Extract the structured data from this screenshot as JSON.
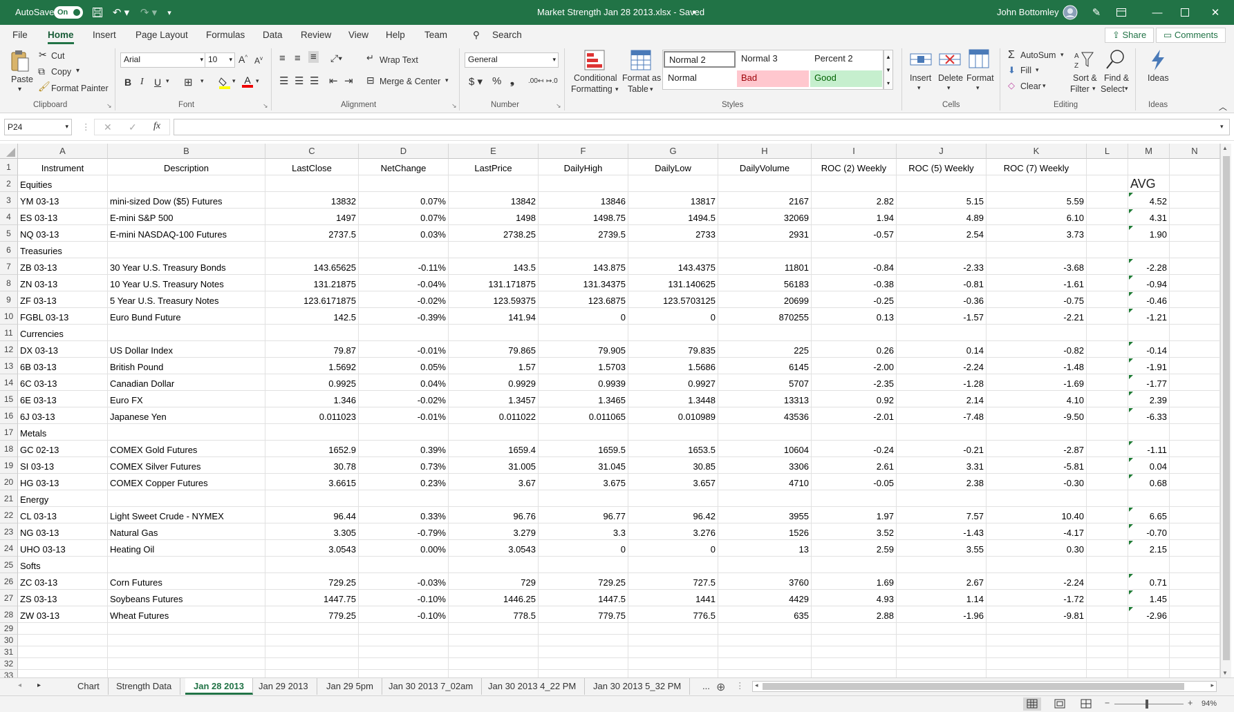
{
  "titlebar": {
    "autosave_label": "AutoSave",
    "autosave_state": "On",
    "file_title": "Market Strength Jan 28 2013.xlsx  -  Saved",
    "user": "John Bottomley"
  },
  "menu": {
    "tabs": [
      "File",
      "Home",
      "Insert",
      "Page Layout",
      "Formulas",
      "Data",
      "Review",
      "View",
      "Help",
      "Team"
    ],
    "search": "Search",
    "share": "Share",
    "comments": "Comments"
  },
  "ribbon": {
    "clipboard": {
      "paste": "Paste",
      "cut": "Cut",
      "copy": "Copy",
      "format_painter": "Format Painter",
      "group": "Clipboard"
    },
    "font": {
      "name": "Arial",
      "size": "10",
      "group": "Font"
    },
    "alignment": {
      "wrap": "Wrap Text",
      "merge": "Merge & Center",
      "group": "Alignment"
    },
    "number": {
      "format": "General",
      "group": "Number"
    },
    "styles": {
      "conditional": "Conditional",
      "conditional2": "Formatting",
      "format_as": "Format as",
      "format_as2": "Table",
      "normal2": "Normal 2",
      "normal3": "Normal 3",
      "percent2": "Percent 2",
      "normal": "Normal",
      "bad": "Bad",
      "good": "Good",
      "group": "Styles"
    },
    "cells": {
      "insert": "Insert",
      "delete": "Delete",
      "format": "Format",
      "group": "Cells"
    },
    "editing": {
      "autosum": "AutoSum",
      "fill": "Fill",
      "clear": "Clear",
      "sort": "Sort &",
      "sort2": "Filter",
      "find": "Find &",
      "find2": "Select",
      "group": "Editing"
    },
    "ideas": {
      "label": "Ideas",
      "group": "Ideas"
    }
  },
  "formula_bar": {
    "name_box": "P24",
    "fx": "fx",
    "value": ""
  },
  "columns": [
    "A",
    "B",
    "C",
    "D",
    "E",
    "F",
    "G",
    "H",
    "I",
    "J",
    "K",
    "L",
    "M",
    "N"
  ],
  "header_row": [
    "Instrument",
    "Description",
    "LastClose",
    "NetChange",
    "LastPrice",
    "DailyHigh",
    "DailyLow",
    "DailyVolume",
    "ROC (2) Weekly",
    "ROC (5) Weekly",
    "ROC (7) Weekly",
    "",
    "",
    ""
  ],
  "avg_label": "AVG",
  "rows": [
    {
      "n": "2",
      "cells": [
        "Equities",
        "",
        "",
        "",
        "",
        "",
        "",
        "",
        "",
        "",
        "",
        "",
        "",
        ""
      ]
    },
    {
      "n": "3",
      "cells": [
        "YM 03-13",
        "mini-sized Dow ($5) Futures",
        "13832",
        "0.07%",
        "13842",
        "13846",
        "13817",
        "2167",
        "2.82",
        "5.15",
        "5.59",
        "",
        "4.52",
        ""
      ]
    },
    {
      "n": "4",
      "cells": [
        "ES 03-13",
        "E-mini S&P 500",
        "1497",
        "0.07%",
        "1498",
        "1498.75",
        "1494.5",
        "32069",
        "1.94",
        "4.89",
        "6.10",
        "",
        "4.31",
        ""
      ]
    },
    {
      "n": "5",
      "cells": [
        "NQ 03-13",
        "E-mini NASDAQ-100 Futures",
        "2737.5",
        "0.03%",
        "2738.25",
        "2739.5",
        "2733",
        "2931",
        "-0.57",
        "2.54",
        "3.73",
        "",
        "1.90",
        ""
      ]
    },
    {
      "n": "6",
      "cells": [
        "Treasuries",
        "",
        "",
        "",
        "",
        "",
        "",
        "",
        "",
        "",
        "",
        "",
        "",
        ""
      ]
    },
    {
      "n": "7",
      "cells": [
        "ZB 03-13",
        "30 Year U.S. Treasury Bonds",
        "143.65625",
        "-0.11%",
        "143.5",
        "143.875",
        "143.4375",
        "11801",
        "-0.84",
        "-2.33",
        "-3.68",
        "",
        "-2.28",
        ""
      ]
    },
    {
      "n": "8",
      "cells": [
        "ZN 03-13",
        "10 Year U.S. Treasury Notes",
        "131.21875",
        "-0.04%",
        "131.171875",
        "131.34375",
        "131.140625",
        "56183",
        "-0.38",
        "-0.81",
        "-1.61",
        "",
        "-0.94",
        ""
      ]
    },
    {
      "n": "9",
      "cells": [
        "ZF 03-13",
        "5 Year U.S. Treasury Notes",
        "123.6171875",
        "-0.02%",
        "123.59375",
        "123.6875",
        "123.5703125",
        "20699",
        "-0.25",
        "-0.36",
        "-0.75",
        "",
        "-0.46",
        ""
      ]
    },
    {
      "n": "10",
      "cells": [
        "FGBL 03-13",
        "Euro Bund Future",
        "142.5",
        "-0.39%",
        "141.94",
        "0",
        "0",
        "870255",
        "0.13",
        "-1.57",
        "-2.21",
        "",
        "-1.21",
        ""
      ]
    },
    {
      "n": "11",
      "cells": [
        "Currencies",
        "",
        "",
        "",
        "",
        "",
        "",
        "",
        "",
        "",
        "",
        "",
        "",
        ""
      ]
    },
    {
      "n": "12",
      "cells": [
        "DX 03-13",
        "US Dollar Index",
        "79.87",
        "-0.01%",
        "79.865",
        "79.905",
        "79.835",
        "225",
        "0.26",
        "0.14",
        "-0.82",
        "",
        "-0.14",
        ""
      ]
    },
    {
      "n": "13",
      "cells": [
        "6B 03-13",
        "British Pound",
        "1.5692",
        "0.05%",
        "1.57",
        "1.5703",
        "1.5686",
        "6145",
        "-2.00",
        "-2.24",
        "-1.48",
        "",
        "-1.91",
        ""
      ]
    },
    {
      "n": "14",
      "cells": [
        "6C 03-13",
        "Canadian Dollar",
        "0.9925",
        "0.04%",
        "0.9929",
        "0.9939",
        "0.9927",
        "5707",
        "-2.35",
        "-1.28",
        "-1.69",
        "",
        "-1.77",
        ""
      ]
    },
    {
      "n": "15",
      "cells": [
        "6E 03-13",
        "Euro FX",
        "1.346",
        "-0.02%",
        "1.3457",
        "1.3465",
        "1.3448",
        "13313",
        "0.92",
        "2.14",
        "4.10",
        "",
        "2.39",
        ""
      ]
    },
    {
      "n": "16",
      "cells": [
        "6J 03-13",
        "Japanese Yen",
        "0.011023",
        "-0.01%",
        "0.011022",
        "0.011065",
        "0.010989",
        "43536",
        "-2.01",
        "-7.48",
        "-9.50",
        "",
        "-6.33",
        ""
      ]
    },
    {
      "n": "17",
      "cells": [
        "Metals",
        "",
        "",
        "",
        "",
        "",
        "",
        "",
        "",
        "",
        "",
        "",
        "",
        ""
      ]
    },
    {
      "n": "18",
      "cells": [
        "GC 02-13",
        "COMEX Gold Futures",
        "1652.9",
        "0.39%",
        "1659.4",
        "1659.5",
        "1653.5",
        "10604",
        "-0.24",
        "-0.21",
        "-2.87",
        "",
        "-1.11",
        ""
      ]
    },
    {
      "n": "19",
      "cells": [
        "SI 03-13",
        "COMEX Silver Futures",
        "30.78",
        "0.73%",
        "31.005",
        "31.045",
        "30.85",
        "3306",
        "2.61",
        "3.31",
        "-5.81",
        "",
        "0.04",
        ""
      ]
    },
    {
      "n": "20",
      "cells": [
        "HG 03-13",
        "COMEX Copper Futures",
        "3.6615",
        "0.23%",
        "3.67",
        "3.675",
        "3.657",
        "4710",
        "-0.05",
        "2.38",
        "-0.30",
        "",
        "0.68",
        ""
      ]
    },
    {
      "n": "21",
      "cells": [
        "Energy",
        "",
        "",
        "",
        "",
        "",
        "",
        "",
        "",
        "",
        "",
        "",
        "",
        ""
      ]
    },
    {
      "n": "22",
      "cells": [
        "CL 03-13",
        "Light Sweet Crude - NYMEX",
        "96.44",
        "0.33%",
        "96.76",
        "96.77",
        "96.42",
        "3955",
        "1.97",
        "7.57",
        "10.40",
        "",
        "6.65",
        ""
      ]
    },
    {
      "n": "23",
      "cells": [
        "NG 03-13",
        "Natural Gas",
        "3.305",
        "-0.79%",
        "3.279",
        "3.3",
        "3.276",
        "1526",
        "3.52",
        "-1.43",
        "-4.17",
        "",
        "-0.70",
        ""
      ]
    },
    {
      "n": "24",
      "cells": [
        "UHO 03-13",
        "Heating Oil",
        "3.0543",
        "0.00%",
        "3.0543",
        "0",
        "0",
        "13",
        "2.59",
        "3.55",
        "0.30",
        "",
        "2.15",
        ""
      ]
    },
    {
      "n": "25",
      "cells": [
        "Softs",
        "",
        "",
        "",
        "",
        "",
        "",
        "",
        "",
        "",
        "",
        "",
        "",
        ""
      ]
    },
    {
      "n": "26",
      "cells": [
        "ZC 03-13",
        "Corn Futures",
        "729.25",
        "-0.03%",
        "729",
        "729.25",
        "727.5",
        "3760",
        "1.69",
        "2.67",
        "-2.24",
        "",
        "0.71",
        ""
      ]
    },
    {
      "n": "27",
      "cells": [
        "ZS 03-13",
        "Soybeans Futures",
        "1447.75",
        "-0.10%",
        "1446.25",
        "1447.5",
        "1441",
        "4429",
        "4.93",
        "1.14",
        "-1.72",
        "",
        "1.45",
        ""
      ]
    },
    {
      "n": "28",
      "cells": [
        "ZW 03-13",
        "Wheat Futures",
        "779.25",
        "-0.10%",
        "778.5",
        "779.75",
        "776.5",
        "635",
        "2.88",
        "-1.96",
        "-9.81",
        "",
        "-2.96",
        ""
      ]
    }
  ],
  "empty_rows": [
    "29",
    "30",
    "31",
    "32",
    "33"
  ],
  "sheet_tabs": [
    "Chart",
    "Strength Data",
    "Jan 28 2013",
    "Jan 29 2013",
    "Jan 29 5pm",
    "Jan 30 2013 7_02am",
    "Jan 30 2013 4_22 PM",
    "Jan 30 2013 5_32 PM",
    "..."
  ],
  "active_sheet": "Jan 28 2013",
  "status": {
    "zoom": "94%"
  },
  "colors": {
    "brand": "#217346",
    "bad_bg": "#ffc7ce",
    "bad_fg": "#9c0006",
    "good_bg": "#c6efce",
    "good_fg": "#006100"
  }
}
